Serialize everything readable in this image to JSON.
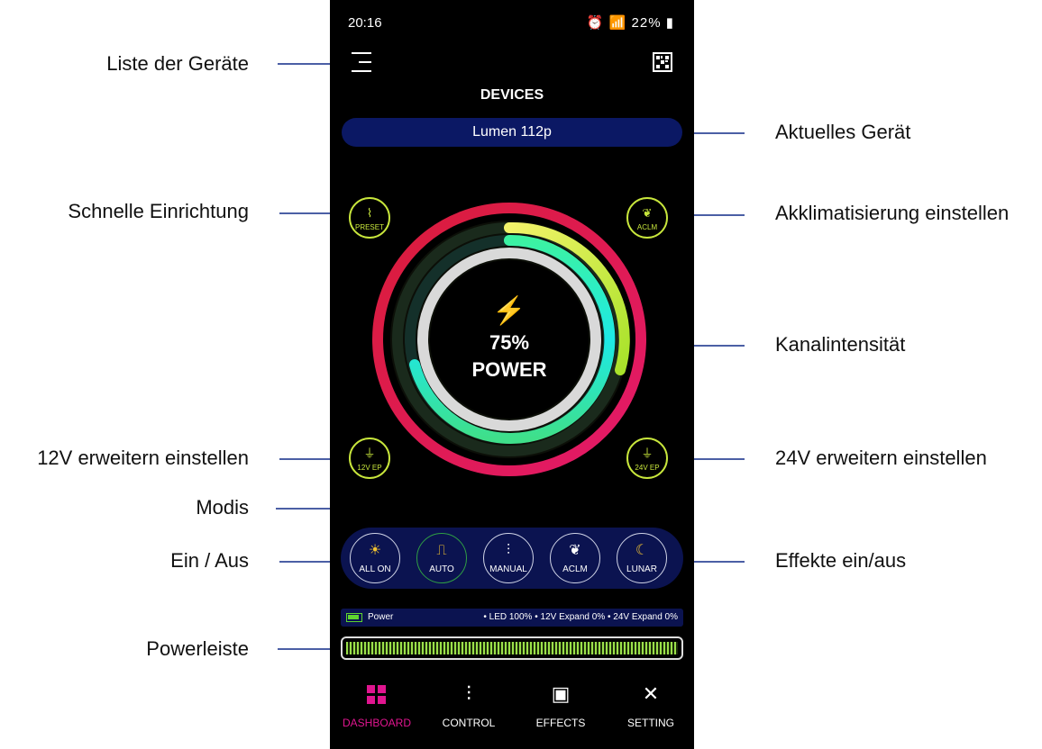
{
  "annotations": {
    "device_list": "Liste der Geräte",
    "current_device": "Aktuelles Gerät",
    "quick_setup": "Schnelle Einrichtung",
    "acclimation": "Akklimatisierung einstellen",
    "channel_intensity": "Kanalintensität",
    "expand_12v": "12V erweitern einstellen",
    "expand_24v": "24V erweitern einstellen",
    "modes": "Modis",
    "on_off": "Ein / Aus",
    "effects": "Effekte ein/aus",
    "power_bar": "Powerleiste"
  },
  "status": {
    "time": "20:16",
    "battery": "22%"
  },
  "header": {
    "title": "DEVICES",
    "device": "Lumen 112p"
  },
  "quick_buttons": {
    "preset": "PRESET",
    "aclm": "ACLM",
    "ep12": "12V EP",
    "ep24": "24V EP"
  },
  "dial": {
    "percent": "75%",
    "label": "POWER",
    "power_level": 0.75
  },
  "modes": {
    "all_on": "ALL ON",
    "auto": "AUTO",
    "manual": "MANUAL",
    "aclm": "ACLM",
    "lunar": "LUNAR"
  },
  "power_info": {
    "label": "Power",
    "stats": "• LED 100%  • 12V Expand 0%  • 24V Expand 0%",
    "strip_fill": 1.0
  },
  "nav": {
    "dashboard": "DASHBOARD",
    "control": "CONTROL",
    "effects": "EFFECTS",
    "setting": "SETTING"
  },
  "colors": {
    "accent": "#e0158f",
    "device_bar": "#0b1864",
    "mode_bar": "#0b1350",
    "button_ring": "#c8e63c",
    "annotation_line": "#4b5fa5"
  }
}
